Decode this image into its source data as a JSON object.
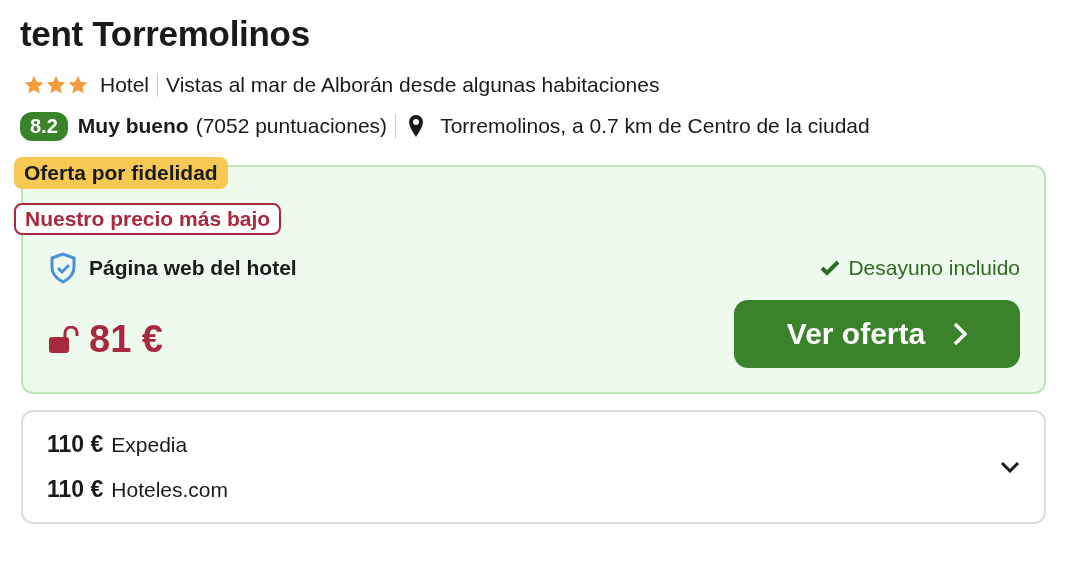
{
  "hotel": {
    "name": "tent Torremolinos",
    "stars": 3,
    "type": "Hotel",
    "feature": "Vistas al mar de Alborán desde algunas habitaciones",
    "rating": {
      "score": "8.2",
      "label": "Muy bueno",
      "count": "(7052 puntuaciones)"
    },
    "location": "Torremolinos, a 0.7 km de Centro de la ciudad"
  },
  "offer": {
    "badges": [
      {
        "kind": "loyalty",
        "label": "Oferta por fidelidad"
      },
      {
        "kind": "lowest",
        "label": "Nuestro precio más bajo"
      }
    ],
    "provider": "Página web del hotel",
    "perk": "Desayuno incluido",
    "price": "81 €",
    "button": "Ver oferta"
  },
  "alternatives": [
    {
      "price": "110 €",
      "provider": "Expedia"
    },
    {
      "price": "110 €",
      "provider": "Hoteles.com"
    }
  ]
}
